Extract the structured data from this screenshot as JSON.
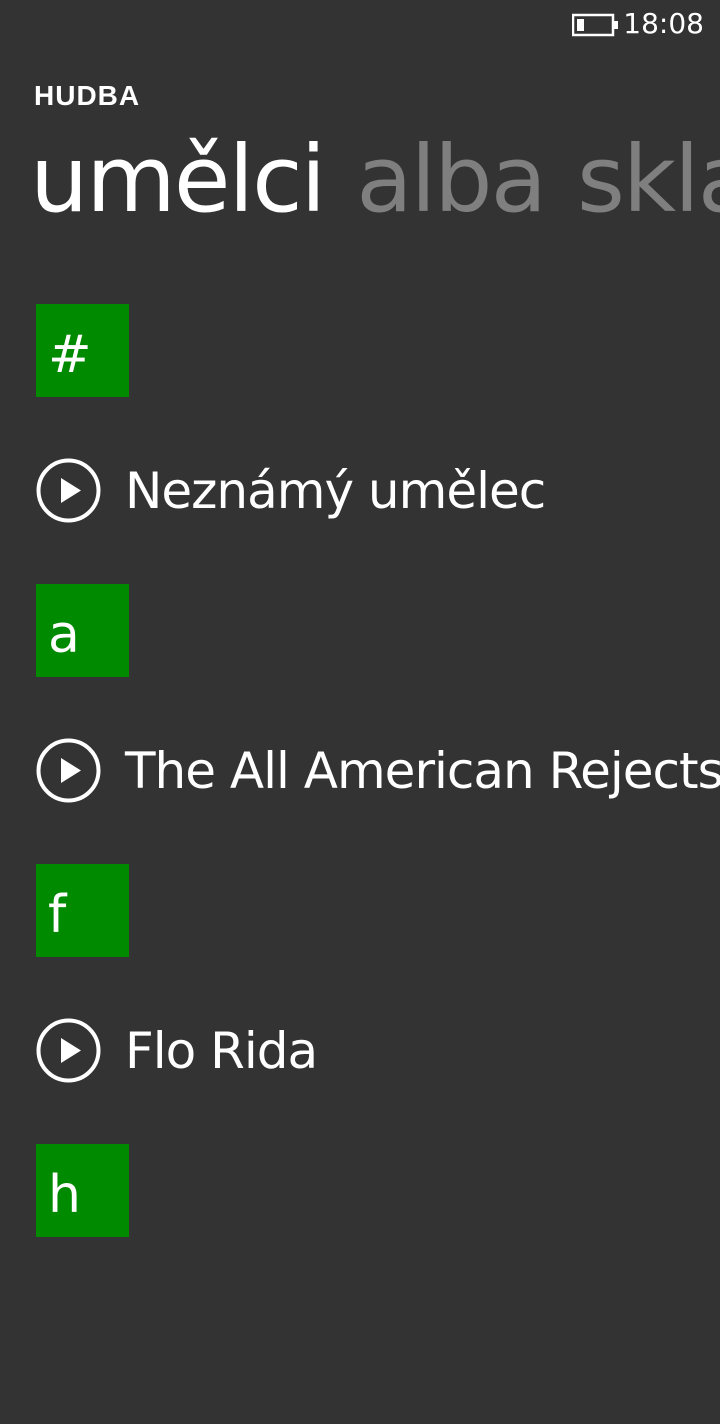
{
  "status_bar": {
    "time": "18:08",
    "battery_icon": "battery-low-icon"
  },
  "header": {
    "app_title": "HUDBA"
  },
  "pivot": {
    "tabs": [
      {
        "label": "umělci",
        "active": true
      },
      {
        "label": "alba",
        "active": false
      },
      {
        "label": "skla",
        "active": false
      }
    ]
  },
  "groups": [
    {
      "letter": "#",
      "artists": [
        {
          "name": "Neznámý umělec",
          "icon": "play-icon"
        }
      ]
    },
    {
      "letter": "a",
      "artists": [
        {
          "name": "The All American Rejects",
          "icon": "play-icon"
        }
      ]
    },
    {
      "letter": "f",
      "artists": [
        {
          "name": "Flo Rida",
          "icon": "play-icon"
        }
      ]
    },
    {
      "letter": "h",
      "artists": []
    }
  ],
  "colors": {
    "background": "#333333",
    "accent": "#008a00",
    "text": "#ffffff",
    "inactive_text": "#7f7f7f"
  }
}
